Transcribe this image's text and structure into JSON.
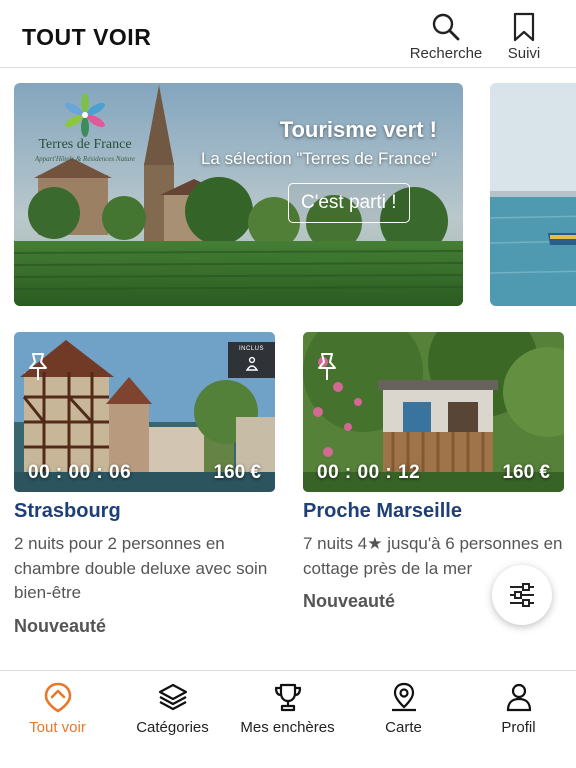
{
  "header": {
    "title": "TOUT VOIR",
    "search_label": "Recherche",
    "follow_label": "Suivi"
  },
  "banner": {
    "headline": "Tourisme vert !",
    "subtitle": "La sélection \"Terres de France\"",
    "cta_label": "C'est parti !",
    "logo_name": "Terres de France",
    "logo_tagline": "Appart'Hôtels & Résidences Nature"
  },
  "cards": [
    {
      "timer": "00 : 00 : 06",
      "price": "160 €",
      "badge": "INCLUS",
      "title": "Strasbourg",
      "description": "2 nuits pour 2 personnes en chambre double deluxe avec soin bien-être",
      "tag": "Nouveauté"
    },
    {
      "timer": "00 : 00 : 12",
      "price": "160 €",
      "title": "Proche Marseille",
      "description": "7 nuits 4★ jusqu'à 6 personnes en cottage près de la mer",
      "tag": "Nouveauté"
    }
  ],
  "bottom_nav": {
    "items": [
      {
        "label": "Tout voir",
        "icon": "all-icon",
        "active": true
      },
      {
        "label": "Catégories",
        "icon": "layers-icon",
        "active": false
      },
      {
        "label": "Mes enchères",
        "icon": "trophy-icon",
        "active": false
      },
      {
        "label": "Carte",
        "icon": "map-pin-icon",
        "active": false
      },
      {
        "label": "Profil",
        "icon": "user-icon",
        "active": false
      }
    ]
  },
  "colors": {
    "accent": "#e8782a",
    "title_blue": "#1e3f77",
    "text_gray": "#555555"
  }
}
